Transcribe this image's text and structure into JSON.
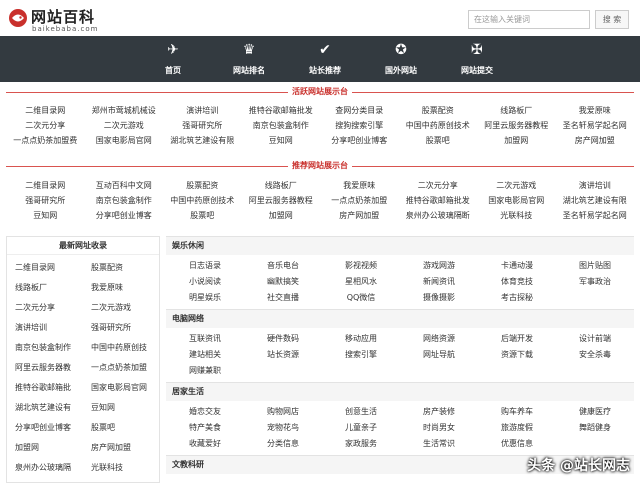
{
  "header": {
    "logo_text": "网站百科",
    "logo_sub": "baikebaba.com",
    "search_placeholder": "在这输入关键词",
    "search_button": "搜 索"
  },
  "nav": {
    "items": [
      {
        "label": "首页",
        "icon": "plane-icon",
        "glyph": "✈"
      },
      {
        "label": "网站排名",
        "icon": "crown-icon",
        "glyph": "♛"
      },
      {
        "label": "站长推荐",
        "icon": "check-icon",
        "glyph": "✔"
      },
      {
        "label": "国外网站",
        "icon": "star-badge-icon",
        "glyph": "✪"
      },
      {
        "label": "网站提交",
        "icon": "cross-icon",
        "glyph": "✠"
      }
    ]
  },
  "active_section": {
    "title": "活跃网站展示台",
    "links": [
      "二维目录网",
      "郑州市莺城机械设",
      "演讲培训",
      "推特谷歌邮箱批发",
      "查网分类目录",
      "股票配资",
      "线路板厂",
      "我爱原味",
      "二次元分享",
      "二次元游戏",
      "强哥研究所",
      "南京包装盒制作",
      "搜狗搜索引擎",
      "中国中药原创技术",
      "阿里云服务器教程",
      "圣名轩易学起名网",
      "一点点奶茶加盟费",
      "国家电影局官网",
      "湖北筑艺建设有限",
      "豆知网",
      "分享吧创业博客",
      "股票吧",
      "加盟网",
      "房产网加盟"
    ]
  },
  "recommend_section": {
    "title": "推荐网站展示台",
    "links": [
      "二维目录网",
      "互动百科中文网",
      "股票配资",
      "线路板厂",
      "我爱原味",
      "二次元分享",
      "二次元游戏",
      "演讲培训",
      "强哥研究所",
      "南京包装盒制作",
      "中国中药原创技术",
      "阿里云服务器教程",
      "一点点奶茶加盟",
      "推特谷歌邮箱批发",
      "国家电影局官网",
      "湖北筑艺建设有限",
      "豆知网",
      "分享吧创业博客",
      "股票吧",
      "加盟网",
      "房产网加盟",
      "泉州办公玻璃隔断",
      "光联科技",
      "圣名轩易学起名网"
    ]
  },
  "latest": {
    "title": "最新网址收录",
    "links": [
      "二维目录网",
      "股票配资",
      "线路板厂",
      "我爱原味",
      "二次元分享",
      "二次元游戏",
      "演讲培训",
      "强哥研究所",
      "南京包装盒制作",
      "中国中药原创技",
      "阿里云服务器教",
      "一点点奶茶加盟",
      "推特谷歌邮箱批",
      "国家电影局官网",
      "湖北筑艺建设有",
      "豆知网",
      "分享吧创业博客",
      "股票吧",
      "加盟网",
      "房产网加盟",
      "泉州办公玻璃隔",
      "光联科技"
    ]
  },
  "categories": [
    {
      "name": "娱乐休闲",
      "links": [
        "日志语录",
        "音乐电台",
        "影视视频",
        "游戏网游",
        "卡通动漫",
        "图片贴图",
        "小说阅读",
        "幽默搞笑",
        "星相风水",
        "新闻资讯",
        "体育竞技",
        "军事政治",
        "明星娱乐",
        "社交直播",
        "QQ微信",
        "摄像摄影",
        "考古探秘"
      ]
    },
    {
      "name": "电脑网络",
      "links": [
        "互联资讯",
        "硬件数码",
        "移动应用",
        "网络资源",
        "后端开发",
        "设计前端",
        "建站相关",
        "站长资源",
        "搜索引擎",
        "网址导航",
        "资源下载",
        "安全杀毒",
        "网赚兼职"
      ]
    },
    {
      "name": "居家生活",
      "links": [
        "婚恋交友",
        "购物网店",
        "创意生活",
        "房产装修",
        "购车养车",
        "健康医疗",
        "特产美食",
        "宠物花鸟",
        "儿童亲子",
        "时尚男女",
        "旅游度假",
        "舞蹈健身",
        "收藏爱好",
        "分类信息",
        "家政服务",
        "生活常识",
        "优惠信息"
      ]
    },
    {
      "name": "文教科研",
      "links": []
    }
  ],
  "watermark": "头条 @站长网志"
}
